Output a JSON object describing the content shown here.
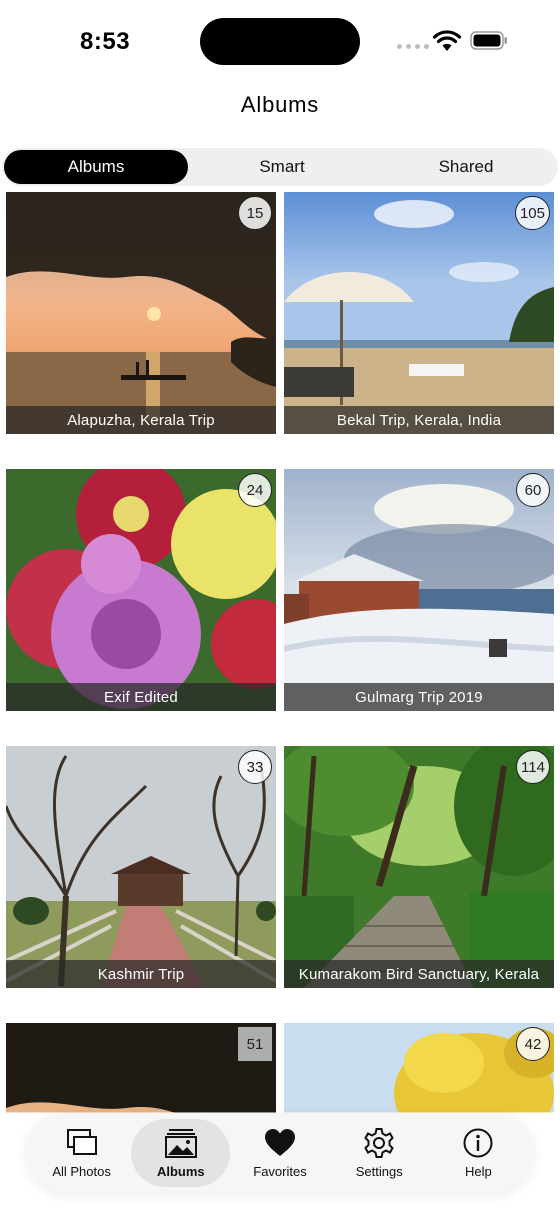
{
  "status": {
    "time": "8:53"
  },
  "nav": {
    "title": "Albums"
  },
  "segments": [
    {
      "label": "Albums",
      "active": true
    },
    {
      "label": "Smart",
      "active": false
    },
    {
      "label": "Shared",
      "active": false
    }
  ],
  "albums": [
    {
      "title": "Alapuzha, Kerala Trip",
      "count": "15"
    },
    {
      "title": "Bekal Trip, Kerala, India",
      "count": "105"
    },
    {
      "title": "Exif Edited",
      "count": "24"
    },
    {
      "title": "Gulmarg Trip 2019",
      "count": "60"
    },
    {
      "title": "Kashmir Trip",
      "count": "33"
    },
    {
      "title": "Kumarakom Bird Sanctuary, Kerala",
      "count": "114"
    },
    {
      "title": "",
      "count": "51"
    },
    {
      "title": "",
      "count": "42"
    }
  ],
  "tabs": [
    {
      "label": "All Photos",
      "icon": "photos-stack-icon"
    },
    {
      "label": "Albums",
      "icon": "album-icon",
      "active": true
    },
    {
      "label": "Favorites",
      "icon": "heart-icon"
    },
    {
      "label": "Settings",
      "icon": "gear-icon"
    },
    {
      "label": "Help",
      "icon": "info-icon"
    }
  ]
}
